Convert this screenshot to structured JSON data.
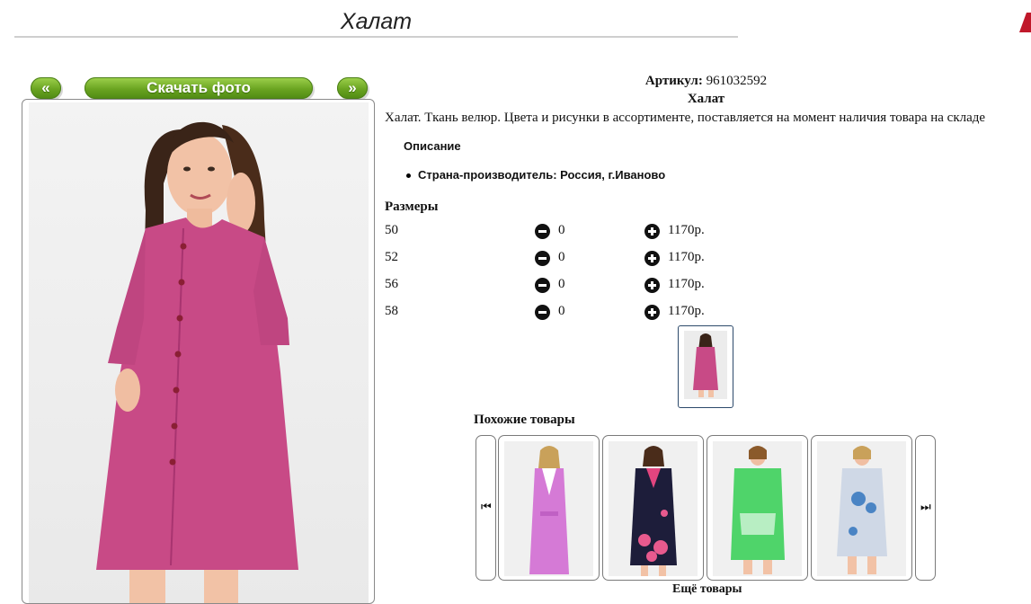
{
  "page": {
    "title": "Халат"
  },
  "gallery": {
    "prev_label": "«",
    "download_label": "Скачать фото",
    "next_label": "»"
  },
  "product": {
    "sku_label": "Артикул:",
    "sku_value": "961032592",
    "name": "Халат",
    "description": "Халат. Ткань велюр. Цвета и рисунки в ассортименте, поставляется на момент наличия товара на складе",
    "description_heading": "Описание",
    "features": [
      "Страна-производитель: Россия, г.Иваново"
    ]
  },
  "sizes": {
    "heading": "Размеры",
    "rows": [
      {
        "size": "50",
        "qty": "0",
        "price": "1170р."
      },
      {
        "size": "52",
        "qty": "0",
        "price": "1170р."
      },
      {
        "size": "56",
        "qty": "0",
        "price": "1170р."
      },
      {
        "size": "58",
        "qty": "0",
        "price": "1170р."
      }
    ]
  },
  "similar": {
    "heading": "Похожие товары",
    "more_label": "Ещё товары",
    "prev_icon": "skip-previous-icon",
    "next_icon": "skip-next-icon"
  },
  "colors": {
    "button_green": "#6aa421",
    "robe_pink": "#c84a86",
    "frame_border": "#8a8a8a"
  }
}
